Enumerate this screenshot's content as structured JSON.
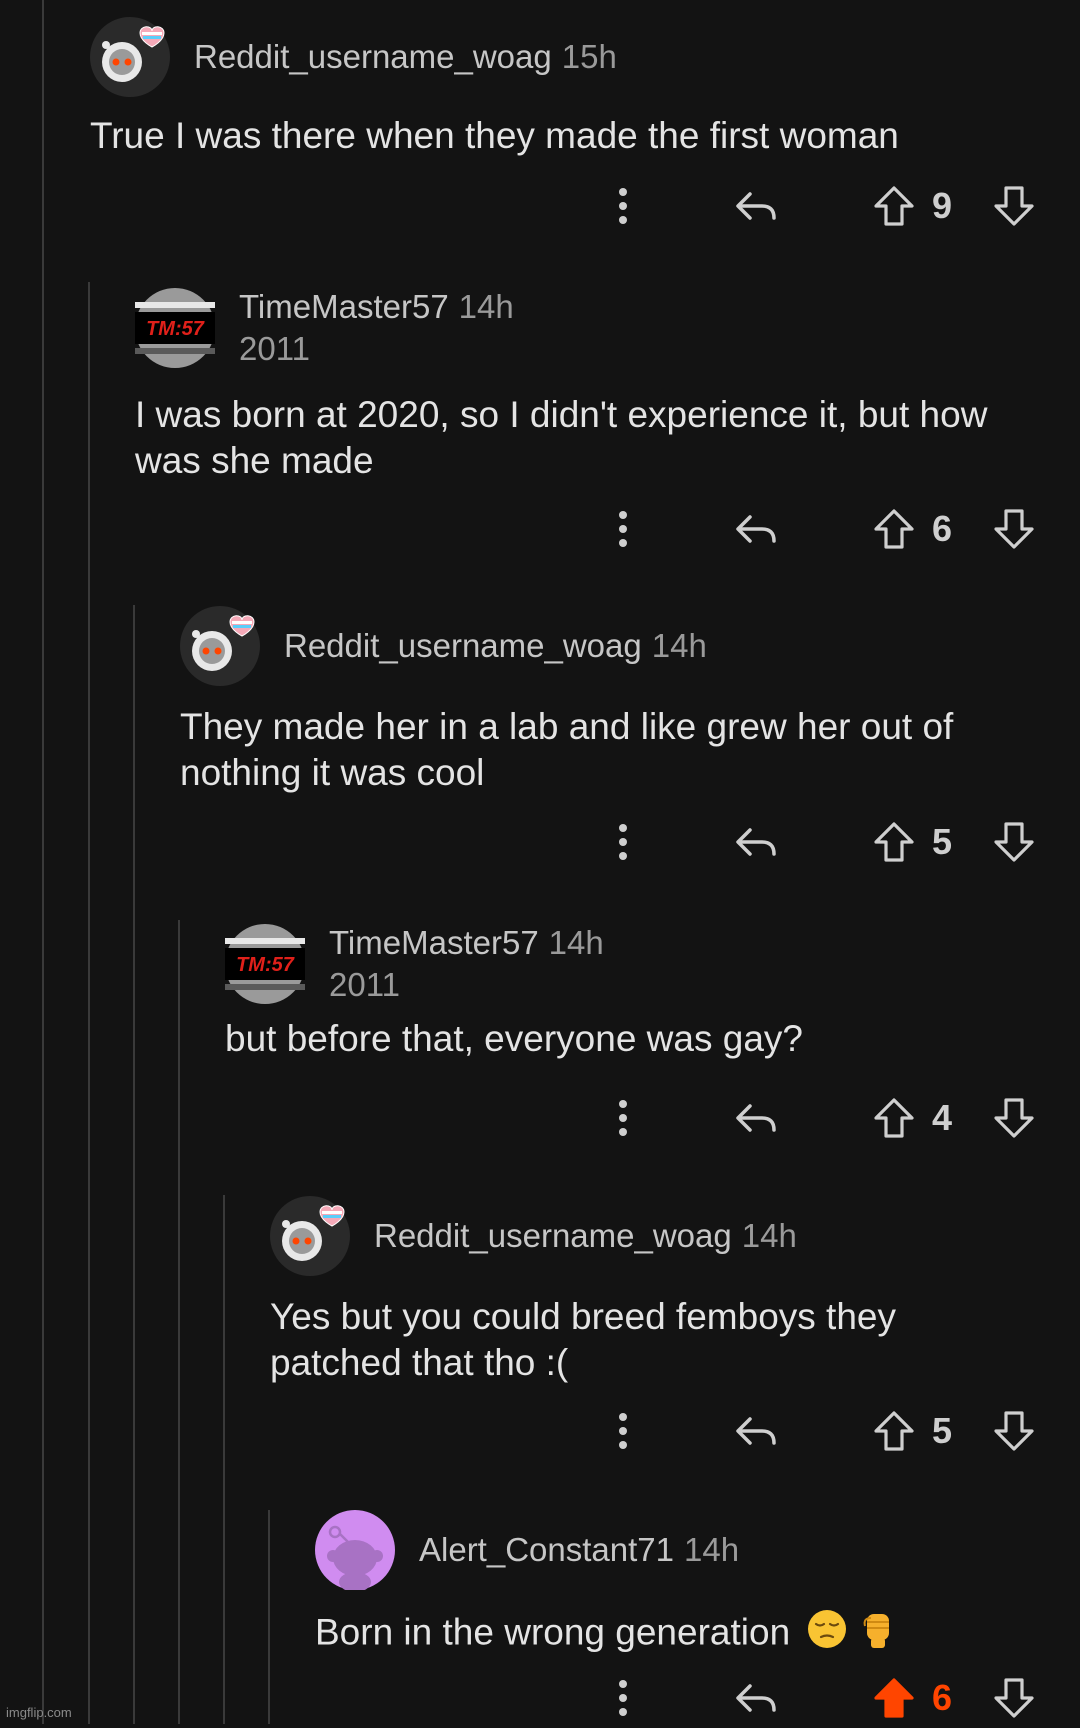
{
  "comments": [
    {
      "username": "Reddit_username_woag",
      "time": "15h",
      "flair": "",
      "body": "True I was there when they made the first woman",
      "score": "9",
      "avatar": "snoo-astronaut-trans-heart",
      "upvoted": false
    },
    {
      "username": "TimeMaster57",
      "time": "14h",
      "flair": "2011",
      "body": "I was born at 2020, so I didn't experience it, but how was she made",
      "score": "6",
      "avatar": "tm57-logo",
      "avatar_text": "TM:57",
      "upvoted": false
    },
    {
      "username": "Reddit_username_woag",
      "time": "14h",
      "flair": "",
      "body": "They made her in a lab and like grew her out of nothing it was cool",
      "score": "5",
      "avatar": "snoo-astronaut-trans-heart",
      "upvoted": false
    },
    {
      "username": "TimeMaster57",
      "time": "14h",
      "flair": "2011",
      "body": "but before that, everyone was gay?",
      "score": "4",
      "avatar": "tm57-logo",
      "avatar_text": "TM:57",
      "upvoted": false
    },
    {
      "username": "Reddit_username_woag",
      "time": "14h",
      "flair": "",
      "body": "Yes but you could breed femboys they patched that tho :(",
      "score": "5",
      "avatar": "snoo-astronaut-trans-heart",
      "upvoted": false
    },
    {
      "username": "Alert_Constant71",
      "time": "14h",
      "flair": "",
      "body": "Born in the wrong generation",
      "body_emoji": [
        "pensive-face-emoji",
        "raised-fist-emoji"
      ],
      "score": "6",
      "avatar": "snoo-purple-default",
      "upvoted": true
    }
  ],
  "icons": {
    "more": "more-vertical-icon",
    "reply": "reply-arrow-icon",
    "upvote": "upvote-arrow-icon",
    "downvote": "downvote-arrow-icon"
  },
  "colors": {
    "background": "#131313",
    "upvote_active": "#ff4500",
    "thread_line": "#3a3a3a",
    "avatar_purple": "#d08cf0"
  },
  "watermark": "imgflip.com"
}
